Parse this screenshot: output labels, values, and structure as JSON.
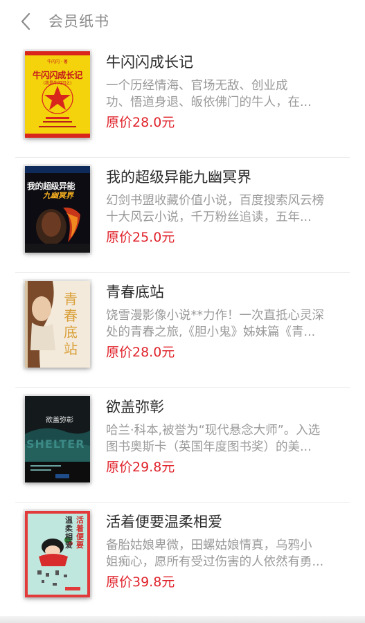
{
  "header": {
    "title": "会员纸书",
    "back_icon": "chevron-left-icon"
  },
  "books": [
    {
      "title": "牛闪闪成长记",
      "desc_line1": "一个历经情海、官场无敌、创业成",
      "desc_line2": "功、悟道身退、皈依佛门的牛人，在...",
      "price": "原价28.0元",
      "cover": {
        "title": "牛闪闪成长记",
        "subtitle": "(我是牛闪闪之)",
        "author": "牛闪闪 · 著"
      }
    },
    {
      "title": "我的超级异能九幽冥界",
      "desc_line1": "幻剑书盟收藏价值小说，百度搜索风云榜",
      "desc_line2": "十大风云小说，千万粉丝追读，五年...",
      "price": "原价25.0元",
      "cover": {
        "title": "我的超级异能",
        "subtitle": "九幽冥界"
      }
    },
    {
      "title": "青春底站",
      "desc_line1": "饶雪漫影像小说**力作！一次直抵心灵深",
      "desc_line2": "处的青春之旅,《胆小鬼》姊妹篇《青...",
      "price": "原价28.0元",
      "cover": {
        "title": "青春底站"
      }
    },
    {
      "title": "欲盖弥彰",
      "desc_line1": "哈兰·科本,被誉为“现代悬念大师”。入选",
      "desc_line2": "图书奥斯卡（英国年度图书奖）的美...",
      "price": "原价29.8元",
      "cover": {
        "title": "欲盖弥彰",
        "en_title": "SHELTER"
      }
    },
    {
      "title": "活着便要温柔相爱",
      "desc_line1": "备胎姑娘卑微，田螺姑娘情真，乌鸦小",
      "desc_line2": "姐痴心，愿所有受过伤害的人依然有勇...",
      "price": "原价39.8元",
      "cover": {
        "title_a": "活着便要",
        "title_b": "温柔相爱"
      }
    }
  ],
  "colors": {
    "price": "#e0232b",
    "title": "#2b2b2b",
    "desc": "#9a9a9a",
    "header": "#8c8c8c"
  }
}
